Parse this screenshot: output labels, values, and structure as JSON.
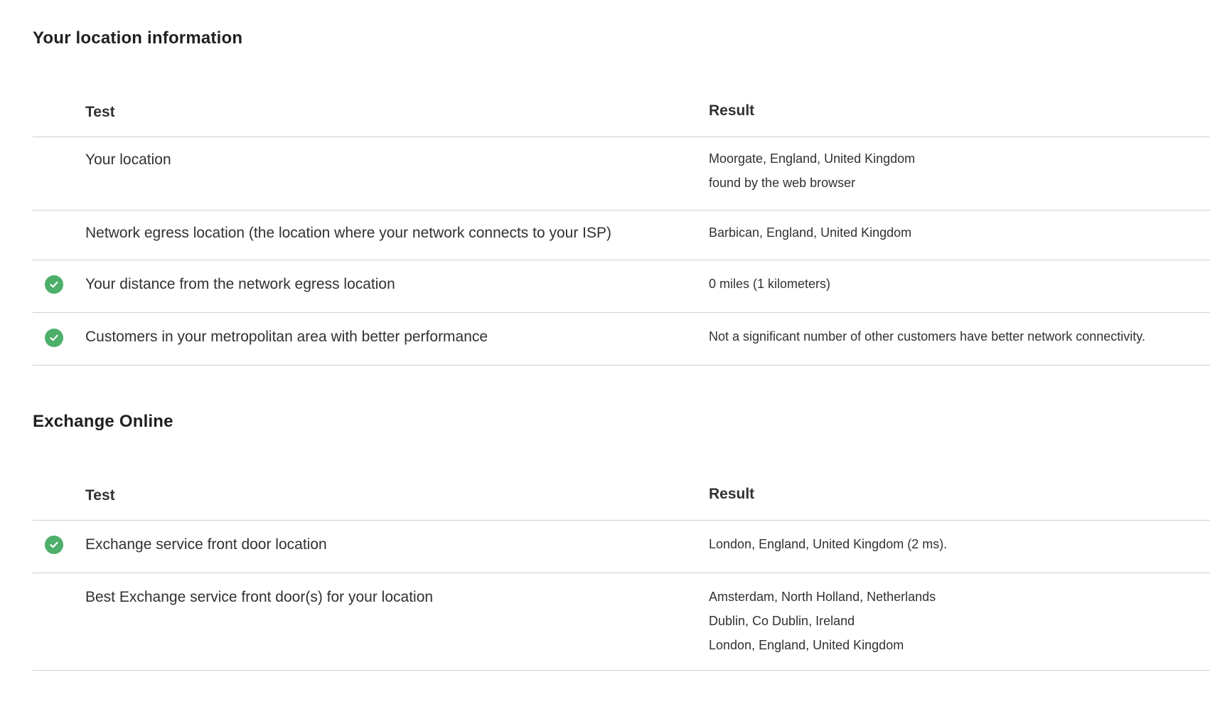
{
  "location_section": {
    "title": "Your location information",
    "header": {
      "test": "Test",
      "result": "Result"
    },
    "rows": [
      {
        "test": "Your location",
        "status": "none",
        "result": [
          "Moorgate, England, United Kingdom",
          "found by the web browser"
        ]
      },
      {
        "test": "Network egress location (the location where your network connects to your ISP)",
        "status": "none",
        "result": [
          "Barbican, England, United Kingdom"
        ]
      },
      {
        "test": "Your distance from the network egress location",
        "status": "pass",
        "result": [
          "0 miles (1 kilometers)"
        ]
      },
      {
        "test": "Customers in your metropolitan area with better performance",
        "status": "pass",
        "result": [
          "Not a significant number of other customers have better network connectivity."
        ]
      }
    ]
  },
  "exchange_section": {
    "title": "Exchange Online",
    "header": {
      "test": "Test",
      "result": "Result"
    },
    "rows": [
      {
        "test": "Exchange service front door location",
        "status": "pass",
        "result": [
          "London, England, United Kingdom (2 ms)."
        ]
      },
      {
        "test": "Best Exchange service front door(s) for your location",
        "status": "none",
        "result": [
          "Amsterdam, North Holland, Netherlands",
          "Dublin, Co Dublin, Ireland",
          "London, England, United Kingdom"
        ]
      }
    ]
  },
  "icons": {
    "pass": "check-circle-icon"
  },
  "colors": {
    "pass": "#4caf6a",
    "divider": "#d2d0ce",
    "text": "#323130"
  }
}
